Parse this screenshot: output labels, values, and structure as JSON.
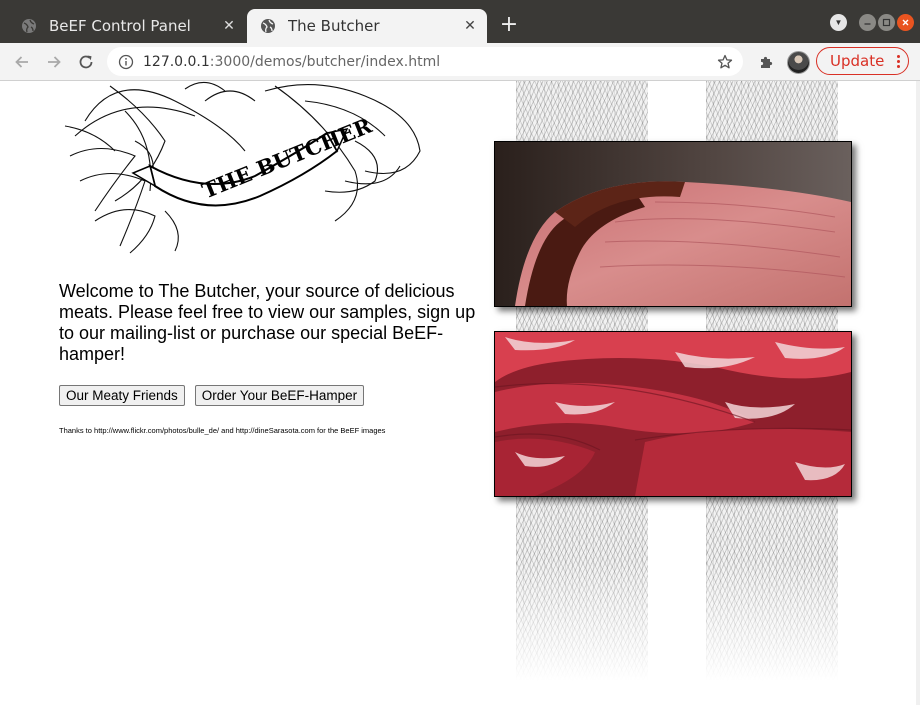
{
  "browser": {
    "tabs": [
      {
        "title": "BeEF Control Panel",
        "active": false,
        "favicon": "globe-icon"
      },
      {
        "title": "The Butcher",
        "active": true,
        "favicon": "globe-icon"
      }
    ],
    "url_host": "127.0.0.1",
    "url_rest": ":3000/demos/butcher/index.html",
    "update_label": "Update",
    "colors": {
      "titlebar": "#3a3936",
      "toolbar": "#f3f3f3",
      "update_red": "#d93025"
    }
  },
  "page": {
    "logo_text": "THE BUTCHER",
    "welcome": "Welcome to The Butcher, your source of delicious meats. Please feel free to view our samples, sign up to our mailing-list or purchase our special BeEF-hamper!",
    "buttons": {
      "meaty_friends": "Our Meaty Friends",
      "hamper": "Order Your BeEF-Hamper"
    },
    "thanks": "Thanks to http://www.flickr.com/photos/bulle_de/ and http://dineSarasota.com for the BeEF images"
  }
}
